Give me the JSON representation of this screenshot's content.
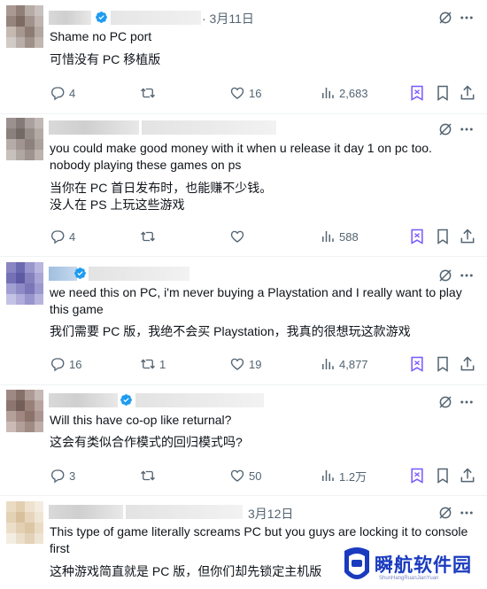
{
  "tweets": [
    {
      "date": "· 3月11日",
      "text": "Shame no PC port",
      "translation": "可惜没有 PC 移植版",
      "replies": "4",
      "reposts": "",
      "likes": "16",
      "views": "2,683"
    },
    {
      "date": "",
      "text": "you could make good money with it when u release it day 1 on pc too.\nnobody playing these games on ps",
      "translation": "当你在 PC 首日发布时，也能赚不少钱。\n没人在 PS 上玩这些游戏",
      "replies": "4",
      "reposts": "",
      "likes": "",
      "views": "588"
    },
    {
      "date": "",
      "text": "we need this on PC, i'm never buying a Playstation and I really want to play\nthis game",
      "translation": "我们需要 PC 版，我绝不会买 Playstation，我真的很想玩这款游戏",
      "replies": "16",
      "reposts": "1",
      "likes": "19",
      "views": "4,877"
    },
    {
      "date": "",
      "text": "Will this have co-op like returnal?",
      "translation": "这会有类似合作模式的回归模式吗?",
      "replies": "3",
      "reposts": "",
      "likes": "50",
      "views": "1.2万"
    },
    {
      "date": "3月12日",
      "text": "This type of game literally screams PC but you guys are locking it to console\nfirst",
      "translation": "这种游戏简直就是 PC 版，但你们却先锁定主机版",
      "replies": "",
      "reposts": "",
      "likes": "",
      "views": ""
    }
  ],
  "watermark": {
    "text": "瞬航软件园",
    "sub": "ShunHangRuanJianYuan"
  },
  "colors": {
    "text": "#0f1419",
    "muted": "#536471",
    "verified": "#1d9bf0",
    "bookmark_purple": "#7856ff"
  },
  "icons": [
    "reply-icon",
    "repost-icon",
    "like-icon",
    "views-icon",
    "grok-icon",
    "bookmark-icon",
    "share-icon",
    "more-icon",
    "verified-icon"
  ]
}
